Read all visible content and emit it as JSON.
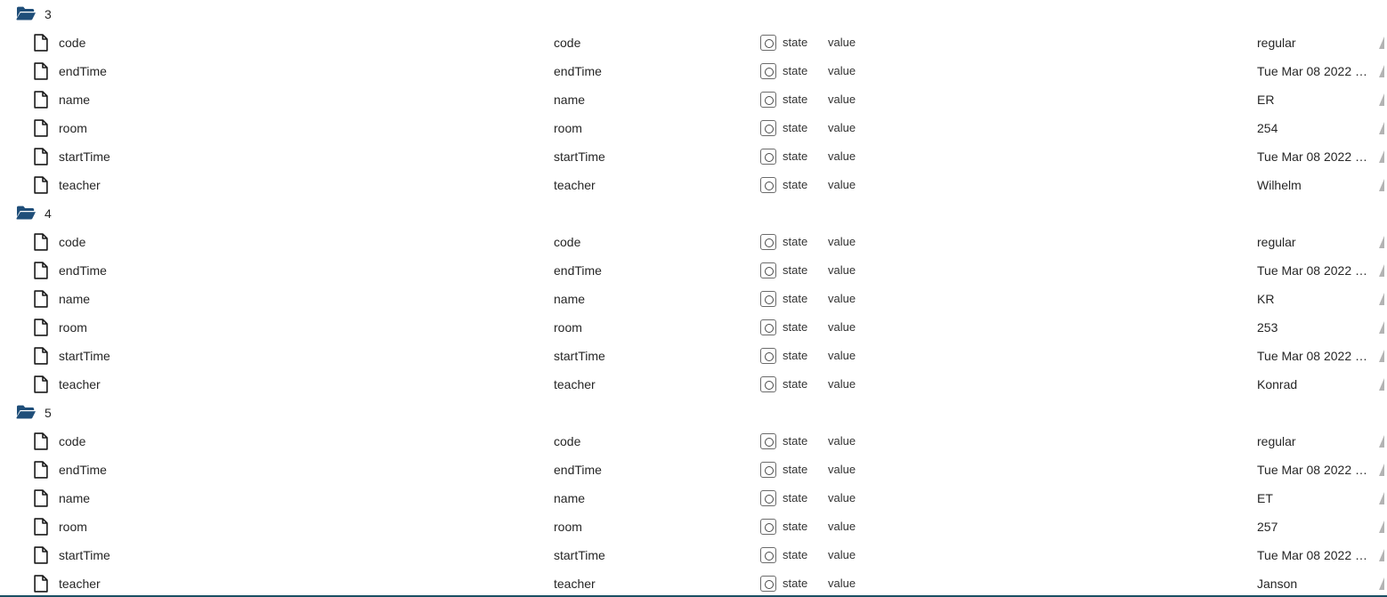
{
  "tree": {
    "icons": {
      "folder": "folder-open-icon",
      "file": "file-icon",
      "state": "state-radio-icon",
      "edge": "resize-handle-icon"
    },
    "labels": {
      "state": "state",
      "value": "value"
    },
    "groups": [
      {
        "label": "3",
        "rows": [
          {
            "name": "code",
            "key": "code",
            "state": "state",
            "value_label": "value",
            "value": "regular"
          },
          {
            "name": "endTime",
            "key": "endTime",
            "state": "state",
            "value_label": "value",
            "value": "Tue Mar 08 2022 …"
          },
          {
            "name": "name",
            "key": "name",
            "state": "state",
            "value_label": "value",
            "value": "ER"
          },
          {
            "name": "room",
            "key": "room",
            "state": "state",
            "value_label": "value",
            "value": "254"
          },
          {
            "name": "startTime",
            "key": "startTime",
            "state": "state",
            "value_label": "value",
            "value": "Tue Mar 08 2022 …"
          },
          {
            "name": "teacher",
            "key": "teacher",
            "state": "state",
            "value_label": "value",
            "value": "Wilhelm"
          }
        ]
      },
      {
        "label": "4",
        "rows": [
          {
            "name": "code",
            "key": "code",
            "state": "state",
            "value_label": "value",
            "value": "regular"
          },
          {
            "name": "endTime",
            "key": "endTime",
            "state": "state",
            "value_label": "value",
            "value": "Tue Mar 08 2022 …"
          },
          {
            "name": "name",
            "key": "name",
            "state": "state",
            "value_label": "value",
            "value": "KR"
          },
          {
            "name": "room",
            "key": "room",
            "state": "state",
            "value_label": "value",
            "value": "253"
          },
          {
            "name": "startTime",
            "key": "startTime",
            "state": "state",
            "value_label": "value",
            "value": "Tue Mar 08 2022 …"
          },
          {
            "name": "teacher",
            "key": "teacher",
            "state": "state",
            "value_label": "value",
            "value": "Konrad"
          }
        ]
      },
      {
        "label": "5",
        "rows": [
          {
            "name": "code",
            "key": "code",
            "state": "state",
            "value_label": "value",
            "value": "regular"
          },
          {
            "name": "endTime",
            "key": "endTime",
            "state": "state",
            "value_label": "value",
            "value": "Tue Mar 08 2022 …"
          },
          {
            "name": "name",
            "key": "name",
            "state": "state",
            "value_label": "value",
            "value": "ET"
          },
          {
            "name": "room",
            "key": "room",
            "state": "state",
            "value_label": "value",
            "value": "257"
          },
          {
            "name": "startTime",
            "key": "startTime",
            "state": "state",
            "value_label": "value",
            "value": "Tue Mar 08 2022 …"
          },
          {
            "name": "teacher",
            "key": "teacher",
            "state": "state",
            "value_label": "value",
            "value": "Janson"
          }
        ]
      }
    ]
  },
  "colors": {
    "folder": "#1f4e79",
    "text": "#262626",
    "bottom_rule": "#1b4f63",
    "edge_handle": "#b3b3b3"
  }
}
